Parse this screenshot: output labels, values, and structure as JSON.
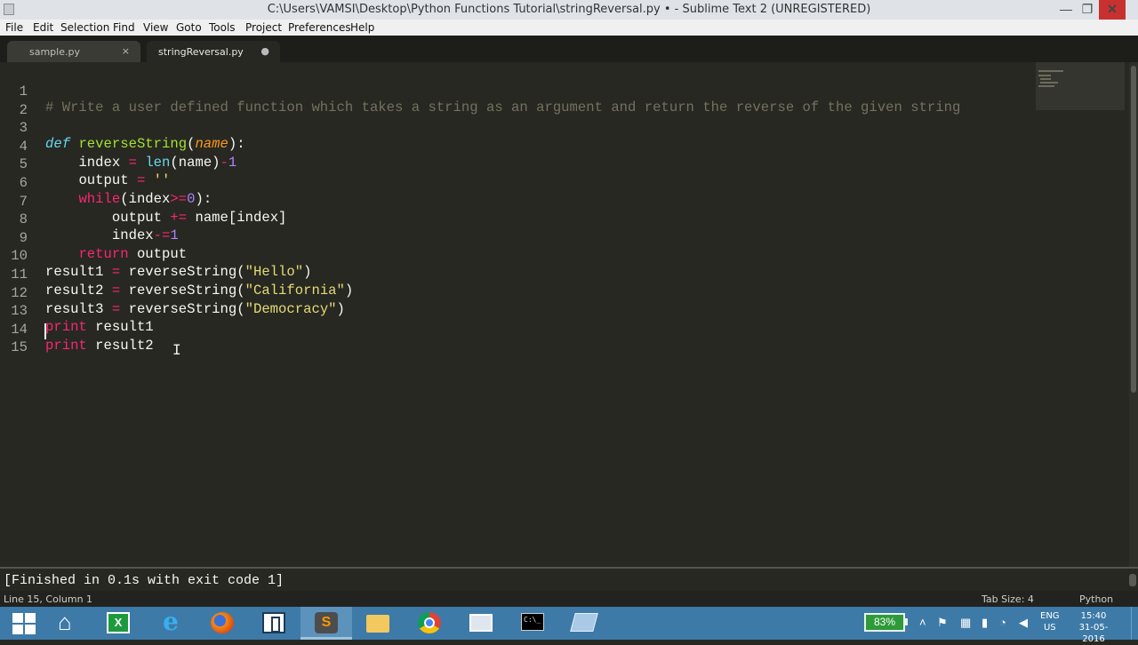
{
  "window": {
    "title": "C:\\Users\\VAMSI\\Desktop\\Python Functions Tutorial\\stringReversal.py • - Sublime Text 2 (UNREGISTERED)",
    "minimize": "—",
    "maximize": "❐",
    "close": "✕"
  },
  "menu": [
    "File",
    "Edit",
    "Selection",
    "Find",
    "View",
    "Goto",
    "Tools",
    "Project",
    "Preferences",
    "Help"
  ],
  "tabs": [
    {
      "label": "sample.py",
      "control": "×"
    },
    {
      "label": "stringReversal.py",
      "control": "●"
    }
  ],
  "editor": {
    "lines": [
      {
        "n": "1"
      },
      {
        "n": "2"
      },
      {
        "n": "3"
      },
      {
        "n": "4"
      },
      {
        "n": "5"
      },
      {
        "n": "6"
      },
      {
        "n": "7"
      },
      {
        "n": "8"
      },
      {
        "n": "9"
      },
      {
        "n": "10"
      },
      {
        "n": "11"
      },
      {
        "n": "12"
      },
      {
        "n": "13"
      },
      {
        "n": "14"
      },
      {
        "n": "15"
      }
    ],
    "tokens": {
      "l1_comment": "# Write a user defined function which takes a string as an argument and return the reverse of the given string",
      "def": "def",
      "fn_name": "reverseString",
      "paren_open": "(",
      "param": "name",
      "paren_close_colon": "):",
      "indent1": "    ",
      "indent2": "        ",
      "index": "index",
      "eq": " = ",
      "len": "len",
      "len_args": "(name)",
      "minus": "-",
      "one": "1",
      "output": "output",
      "empty_str": "''",
      "while": "while",
      "while_open": "(index",
      "gte": ">=",
      "zero": "0",
      "while_close": "):",
      "plus_eq": " += ",
      "name_index": "name[index]",
      "minus_eq": "-=",
      "return": "return",
      "ret_output": " output",
      "result1": "result1",
      "result2": "result2",
      "result3": "result3",
      "call_open": "reverseString(",
      "s_hello": "\"Hello\"",
      "s_california": "\"California\"",
      "s_democracy": "\"Democracy\"",
      "call_close": ")",
      "print": "print",
      "p_result1": " result1",
      "p_result2": " result2"
    }
  },
  "output_panel": "[Finished in 0.1s with exit code 1]",
  "status": {
    "position": "Line 15, Column 1",
    "tab_size": "Tab Size: 4",
    "syntax": "Python"
  },
  "taskbar": {
    "items": [
      "start",
      "home",
      "excel",
      "internet-explorer",
      "firefox",
      "box",
      "sublime-text",
      "file-folder",
      "chrome",
      "explorer",
      "command-prompt",
      "notes"
    ],
    "active": "sublime-text",
    "cmd_label": "C:\\_",
    "excel_label": "X",
    "ie_label": "e",
    "sublime_label": "S",
    "battery": "83%",
    "lang_top": "ENG",
    "lang_bottom": "US",
    "time": "15:40",
    "date": "31-05-2016"
  },
  "colors": {
    "editor_bg": "#272822",
    "comment": "#75715e",
    "keyword": "#f92672",
    "function": "#a6e22e",
    "parameter": "#fd971f",
    "builtin": "#66d9ef",
    "number": "#ae81ff",
    "string": "#e6db74",
    "taskbar": "#3d7aa8"
  }
}
